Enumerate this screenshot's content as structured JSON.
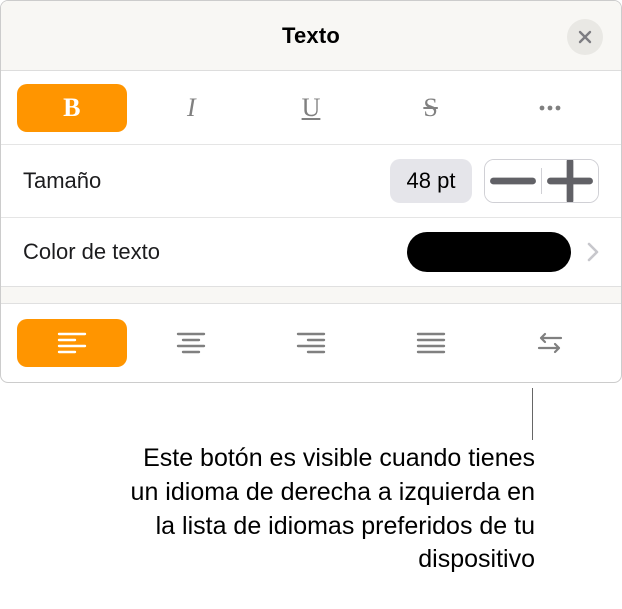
{
  "header": {
    "title": "Texto"
  },
  "styles": {
    "bold_active": true
  },
  "size": {
    "label": "Tamaño",
    "value": "48 pt"
  },
  "color": {
    "label": "Color de texto",
    "hex": "#000000"
  },
  "align": {
    "active": "left"
  },
  "callout": "Este botón es visible cuando tienes un idioma de derecha a izquierda en la lista de idiomas preferidos de tu dispositivo"
}
